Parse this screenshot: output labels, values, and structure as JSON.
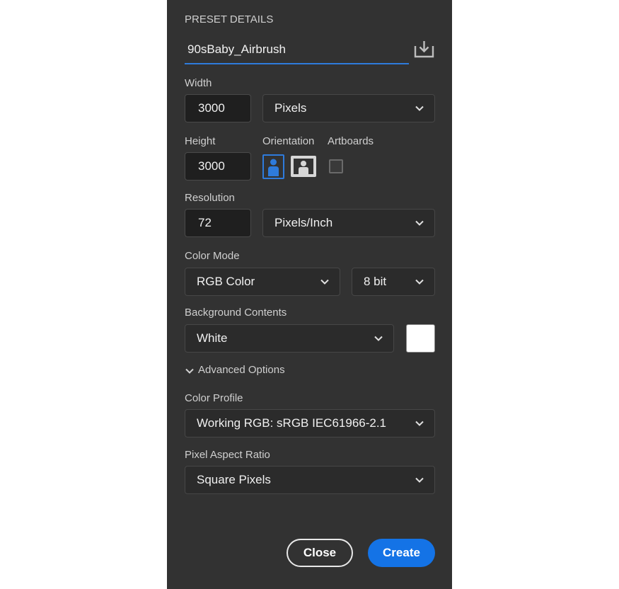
{
  "section_title": "PRESET DETAILS",
  "preset_name": "90sBaby_Airbrush",
  "width": {
    "label": "Width",
    "value": "3000",
    "unit": "Pixels"
  },
  "height": {
    "label": "Height",
    "value": "3000"
  },
  "orientation": {
    "label": "Orientation",
    "selected": "portrait"
  },
  "artboards": {
    "label": "Artboards",
    "checked": false
  },
  "resolution": {
    "label": "Resolution",
    "value": "72",
    "unit": "Pixels/Inch"
  },
  "color_mode": {
    "label": "Color Mode",
    "mode": "RGB Color",
    "depth": "8 bit"
  },
  "background": {
    "label": "Background Contents",
    "value": "White",
    "swatch": "#ffffff"
  },
  "advanced": {
    "label": "Advanced Options"
  },
  "color_profile": {
    "label": "Color Profile",
    "value": "Working RGB: sRGB IEC61966-2.1"
  },
  "pixel_aspect": {
    "label": "Pixel Aspect Ratio",
    "value": "Square Pixels"
  },
  "buttons": {
    "close": "Close",
    "create": "Create"
  },
  "colors": {
    "panel": "#323232",
    "accent": "#1473e6",
    "underline": "#2e7bdc"
  }
}
